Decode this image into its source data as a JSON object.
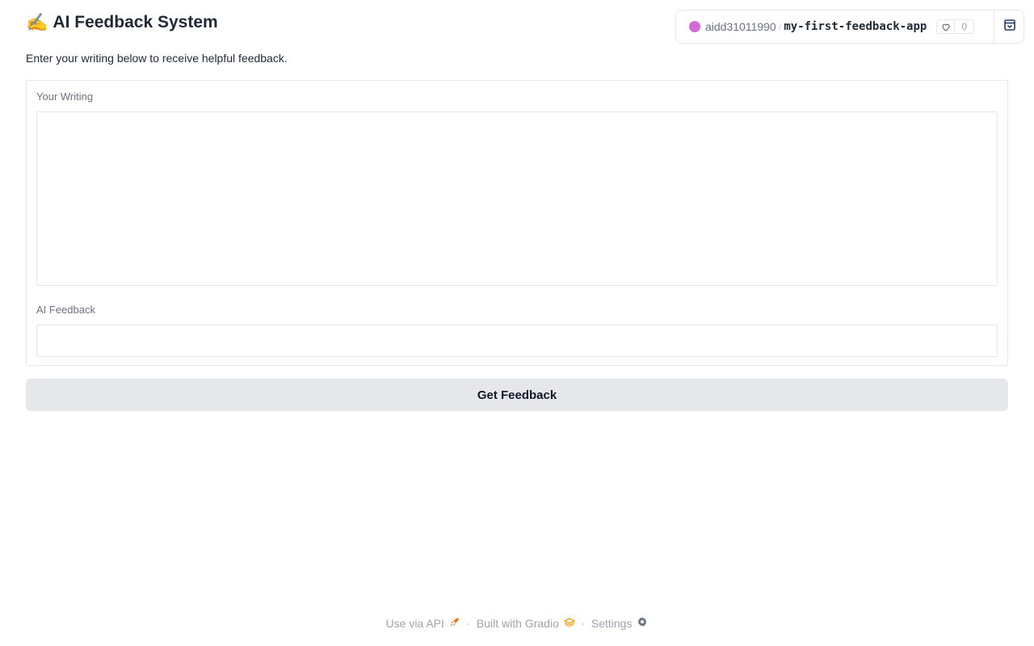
{
  "header": {
    "title_emoji": "✍️",
    "title": "AI Feedback System",
    "subtitle": "Enter your writing below to receive helpful feedback."
  },
  "space": {
    "owner": "aidd31011990",
    "separator": "/",
    "name": "my-first-feedback-app",
    "likes": "0",
    "dot_color": "#d16ad6"
  },
  "form": {
    "writing_label": "Your Writing",
    "writing_value": "",
    "feedback_label": "AI Feedback",
    "feedback_value": "",
    "submit_label": "Get Feedback"
  },
  "footer": {
    "api_label": "Use via API",
    "gradio_label": "Built with Gradio",
    "settings_label": "Settings",
    "separator": "·"
  },
  "colors": {
    "button_bg": "#e5e7eb",
    "gradio_orange": "#f59e0b"
  }
}
